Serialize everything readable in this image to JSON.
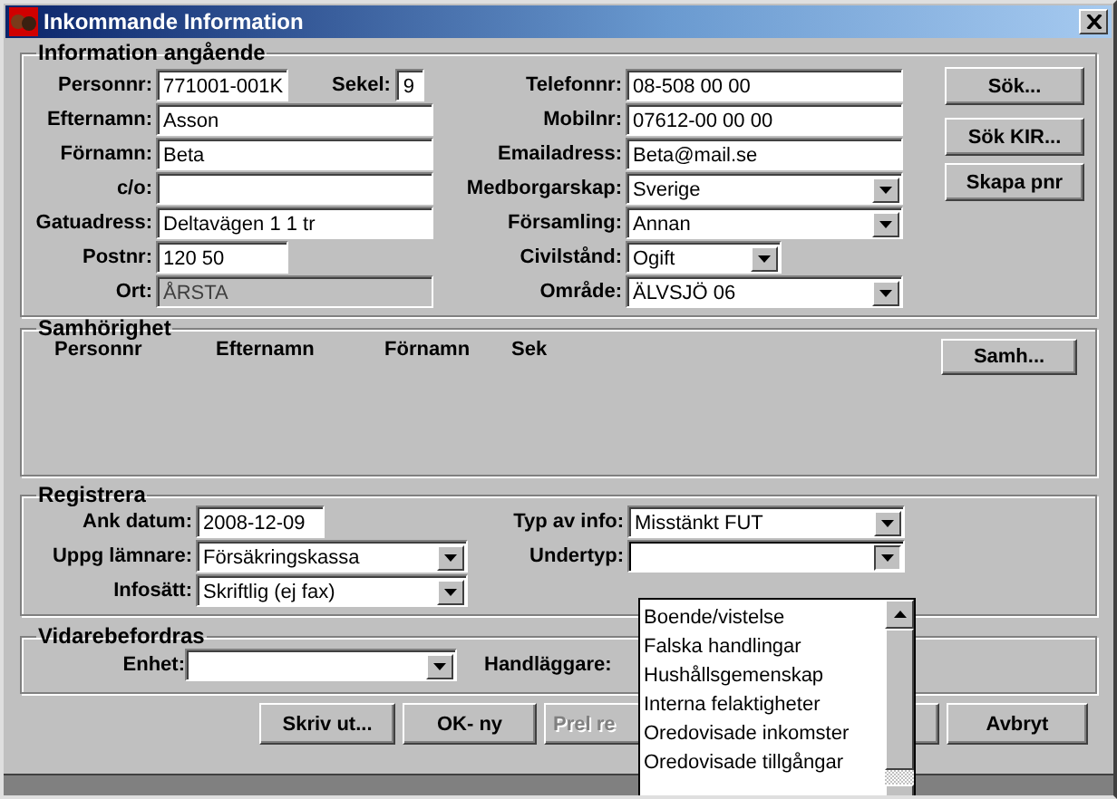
{
  "window": {
    "title": "Inkommande Information"
  },
  "information": {
    "title": "Information angående",
    "left_fields": [
      {
        "label": "Personnr:",
        "value": "771001-001K",
        "kind": "short",
        "disabled": false
      },
      {
        "label": "Efternamn:",
        "value": "Asson",
        "kind": "text",
        "disabled": false
      },
      {
        "label": "Förnamn:",
        "value": "Beta",
        "kind": "text",
        "disabled": false
      },
      {
        "label": "c/o:",
        "kind": "text",
        "disabled": false
      },
      {
        "label": "Gatuadress:",
        "value": "Deltavägen 1 1 tr",
        "kind": "text",
        "disabled": false
      },
      {
        "label": "Postnr:",
        "value": "120 50",
        "kind": "short",
        "disabled": false
      },
      {
        "label": "Ort:",
        "value": "ÅRSTA",
        "kind": "text",
        "disabled": true
      }
    ],
    "sekel": {
      "label": "Sekel:",
      "value": "9"
    },
    "right_fields": [
      {
        "label": "Telefonnr:",
        "value": "08-508 00 00",
        "kind": "text"
      },
      {
        "label": "Mobilnr:",
        "value": "07612-00 00 00",
        "kind": "text"
      },
      {
        "label": "Emailadress:",
        "value": "Beta@mail.se",
        "kind": "text"
      },
      {
        "label": "Medborgarskap:",
        "value": "Sverige",
        "kind": "combo"
      },
      {
        "label": "Församling:",
        "value": "Annan",
        "kind": "combo"
      },
      {
        "label": "Civilstånd:",
        "value": "Ogift",
        "kind": "short_combo"
      },
      {
        "label": "Område:",
        "value": "ÄLVSJÖ 06",
        "kind": "combo"
      }
    ],
    "buttons": [
      "Sök...",
      "Sök KIR...",
      "Skapa pnr"
    ]
  },
  "samhorighet": {
    "title": "Samhörighet",
    "columns": [
      "Personnr",
      "Efternamn",
      "Förnamn",
      "Sek"
    ],
    "button": "Samh..."
  },
  "registrera": {
    "title": "Registrera",
    "left_fields": [
      {
        "label": "Ank datum:",
        "value": "2008-12-09",
        "kind": "date"
      },
      {
        "label": "Uppg lämnare:",
        "value": "Försäkringskassa",
        "kind": "combo"
      },
      {
        "label": "Infosätt:",
        "value": "Skriftlig (ej fax)",
        "kind": "combo"
      }
    ],
    "right_fields": [
      {
        "label": "Typ av info:",
        "value": "Misstänkt FUT",
        "kind": "combo"
      },
      {
        "label": "Undertyp:",
        "kind": "combo",
        "expanded": true
      }
    ],
    "dropdown_items": [
      "Boende/vistelse",
      "Falska handlingar",
      "Hushållsgemenskap",
      "Interna felaktigheter",
      "Oredovisade inkomster",
      "Oredovisade tillgångar"
    ]
  },
  "vidarebefordras": {
    "title": "Vidarebefordras",
    "enhet_label": "Enhet:",
    "handlaggare_label": "Handläggare:"
  },
  "buttons": [
    {
      "label": "Skriv ut...",
      "disabled": false
    },
    {
      "label": "OK- ny",
      "disabled": false
    },
    {
      "label": "Prel re",
      "disabled": true
    },
    {
      "label": "Avbryt",
      "disabled": false
    }
  ]
}
